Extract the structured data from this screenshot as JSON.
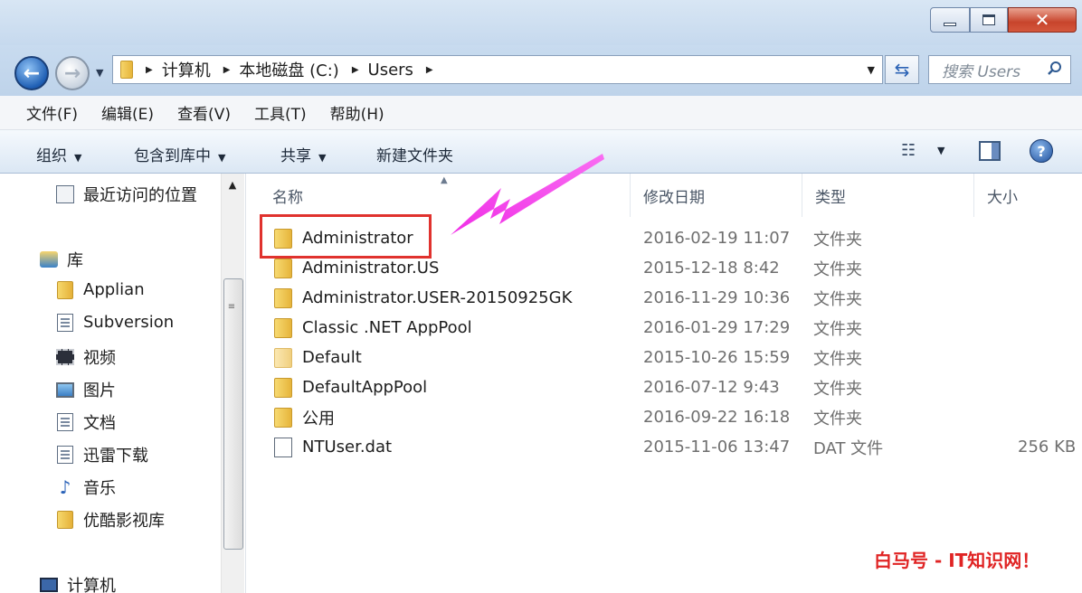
{
  "address": {
    "crumbs": [
      "计算机",
      "本地磁盘 (C:)",
      "Users"
    ]
  },
  "search": {
    "placeholder": "搜索 Users"
  },
  "menu": [
    "文件(F)",
    "编辑(E)",
    "查看(V)",
    "工具(T)",
    "帮助(H)"
  ],
  "toolbar": {
    "organize": "组织",
    "include_library": "包含到库中",
    "share": "共享",
    "new_folder": "新建文件夹"
  },
  "nav": {
    "recent": "最近访问的位置",
    "library": "库",
    "items": [
      {
        "label": "Applian",
        "icon": "folder-icon"
      },
      {
        "label": "Subversion",
        "icon": "document-icon"
      },
      {
        "label": "视频",
        "icon": "video-icon"
      },
      {
        "label": "图片",
        "icon": "picture-icon"
      },
      {
        "label": "文档",
        "icon": "document-icon"
      },
      {
        "label": "迅雷下载",
        "icon": "document-icon"
      },
      {
        "label": "音乐",
        "icon": "music-icon"
      },
      {
        "label": "优酷影视库",
        "icon": "folder-icon"
      }
    ],
    "computer": "计算机"
  },
  "columns": {
    "name": "名称",
    "modified": "修改日期",
    "type": "类型",
    "size": "大小"
  },
  "files": [
    {
      "name": "Administrator",
      "modified": "2016-02-19 11:07",
      "type": "文件夹",
      "size": "",
      "icon": "folder-icon"
    },
    {
      "name": "Administrator.US",
      "modified": "2015-12-18 8:42",
      "type": "文件夹",
      "size": "",
      "icon": "folder-icon"
    },
    {
      "name": "Administrator.USER-20150925GK",
      "modified": "2016-11-29 10:36",
      "type": "文件夹",
      "size": "",
      "icon": "folder-icon"
    },
    {
      "name": "Classic .NET AppPool",
      "modified": "2016-01-29 17:29",
      "type": "文件夹",
      "size": "",
      "icon": "folder-icon"
    },
    {
      "name": "Default",
      "modified": "2015-10-26 15:59",
      "type": "文件夹",
      "size": "",
      "icon": "folder-icon"
    },
    {
      "name": "DefaultAppPool",
      "modified": "2016-07-12 9:43",
      "type": "文件夹",
      "size": "",
      "icon": "folder-icon"
    },
    {
      "name": "公用",
      "modified": "2016-09-22 16:18",
      "type": "文件夹",
      "size": "",
      "icon": "folder-icon"
    },
    {
      "name": "NTUser.dat",
      "modified": "2015-11-06 13:47",
      "type": "DAT 文件",
      "size": "256 KB",
      "icon": "file-icon"
    }
  ],
  "watermark": "白马号 - IT知识网！",
  "colors": {
    "highlight": "#e0322e",
    "annotation_arrow": "#f02ee6",
    "watermark": "#e02424"
  }
}
